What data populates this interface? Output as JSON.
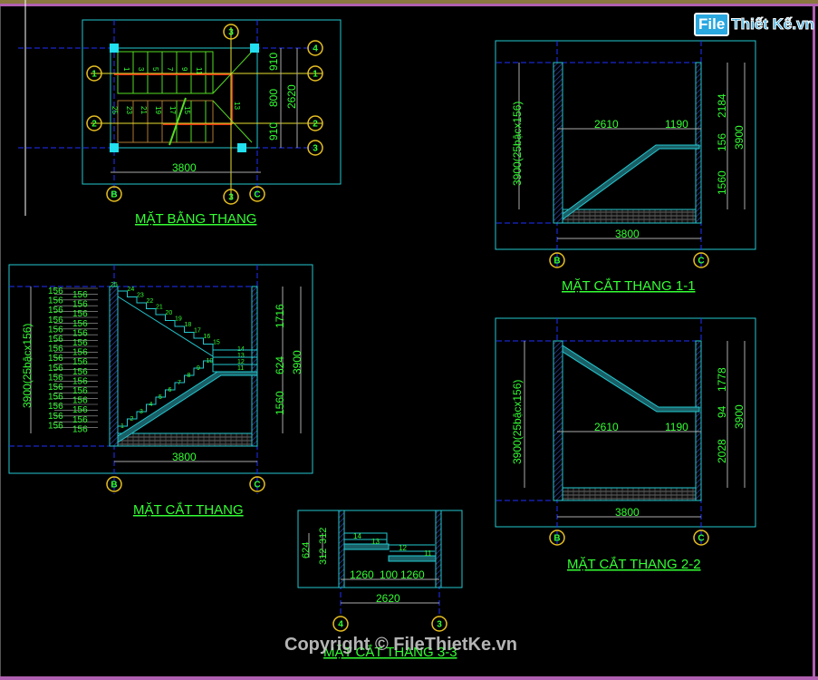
{
  "watermark": "Copyright © FileThietKe.vn",
  "logo": {
    "file": "File",
    "brand": "Thiết Kế.vn"
  },
  "colors": {
    "background": "#000000",
    "frame": "#22c8d0",
    "text": "#33ff33",
    "grid_bubble": "#e8c020",
    "axis": "#2030ff",
    "dim": "#aaaaaa"
  },
  "drawings": {
    "plan": {
      "title": "MẶT BẰNG THANG",
      "width_dim": "3800",
      "right_dims": [
        "910",
        "800",
        "910"
      ],
      "total_dim": "2620",
      "steps_top": [
        "1",
        "3",
        "5",
        "7",
        "9",
        "11"
      ],
      "steps_bottom": [
        "25",
        "23",
        "21",
        "19",
        "17",
        "15"
      ],
      "landing_step": "13",
      "grid_rows": [
        "1",
        "2"
      ],
      "grid_top": "3",
      "grid_bottom": "3",
      "grid_right": [
        "4",
        "3"
      ],
      "grid_cols": [
        "B",
        "C"
      ]
    },
    "section": {
      "title": "MẶT CẮT THANG",
      "height_label": "3900(25bậcx156)",
      "riser": "156",
      "width_dim": "3800",
      "right_dims": [
        "1716",
        "624",
        "1560"
      ],
      "total_dim": "3900",
      "step_numbers": [
        "1",
        "2",
        "3",
        "4",
        "5",
        "6",
        "7",
        "8",
        "9",
        "10",
        "11",
        "12",
        "13",
        "14",
        "15",
        "16",
        "17",
        "18",
        "19",
        "20",
        "21",
        "22",
        "23",
        "24",
        "25"
      ],
      "grid_cols": [
        "B",
        "C"
      ]
    },
    "section_1_1": {
      "title": "MẶT CẮT THANG 1-1",
      "height_label": "3900(25bậcx156)",
      "flight_dim": "2610",
      "landing_dim": "1190",
      "width_dim": "3800",
      "right_dims": [
        "2184",
        "156",
        "1560"
      ],
      "total_dim": "3900",
      "grid_cols": [
        "B",
        "C"
      ]
    },
    "section_2_2": {
      "title": "MẶT CẮT THANG 2-2",
      "height_label": "3900(25bậcx156)",
      "flight_dim": "2610",
      "landing_dim": "1190",
      "width_dim": "3800",
      "right_dims": [
        "1778",
        "94",
        "2028"
      ],
      "total_dim": "3900",
      "grid_cols": [
        "B",
        "C"
      ]
    },
    "section_3_3": {
      "title": "MẶT CẮT THANG 3-3",
      "left_dims": [
        "312",
        "312"
      ],
      "left_total": "624",
      "bottom_dims": [
        "1260",
        "100",
        "1260"
      ],
      "width_dim": "2620",
      "step_numbers": [
        "14",
        "13",
        "12",
        "11"
      ],
      "grid_cols": [
        "4",
        "3"
      ]
    }
  }
}
